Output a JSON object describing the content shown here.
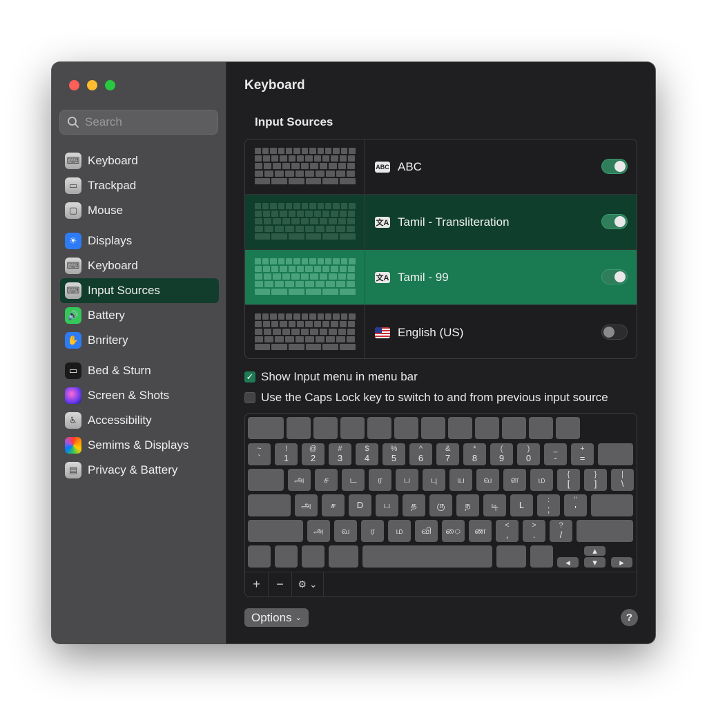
{
  "window": {
    "title": "Keyboard",
    "traffic_lights": [
      "close",
      "minimize",
      "zoom"
    ]
  },
  "sidebar": {
    "search_placeholder": "Search",
    "items": [
      {
        "label": "Keyboard",
        "icon": "keyboard-icon",
        "group": 1
      },
      {
        "label": "Trackpad",
        "icon": "trackpad-icon",
        "group": 1
      },
      {
        "label": "Mouse",
        "icon": "mouse-icon",
        "group": 1
      },
      {
        "label": "Displays",
        "icon": "sun-icon",
        "group": 2
      },
      {
        "label": "Keyboard",
        "icon": "keyboard-icon",
        "group": 2
      },
      {
        "label": "Input Sources",
        "icon": "keyboard-icon",
        "group": 2,
        "selected": true
      },
      {
        "label": "Battery",
        "icon": "speaker-icon",
        "group": 2
      },
      {
        "label": "Bnritery",
        "icon": "hand-icon",
        "group": 2
      },
      {
        "label": "Bed & Sturn",
        "icon": "display-icon",
        "group": 3
      },
      {
        "label": "Screen & Shots",
        "icon": "siri-icon",
        "group": 3
      },
      {
        "label": "Accessibility",
        "icon": "accessibility-icon",
        "group": 3
      },
      {
        "label": "Semims & Displays",
        "icon": "color-icon",
        "group": 3
      },
      {
        "label": "Privacy & Battery",
        "icon": "card-icon",
        "group": 3
      }
    ]
  },
  "main": {
    "section_title": "Input Sources",
    "sources": [
      {
        "name": "ABC",
        "icon": "abc-icon",
        "badge": "ABC",
        "enabled": true,
        "highlight": "none"
      },
      {
        "name": "Tamil - Transliteration",
        "icon": "transliteration-icon",
        "badge": "文A",
        "enabled": true,
        "highlight": "dark"
      },
      {
        "name": "Tamil - 99",
        "icon": "transliteration-icon",
        "badge": "文A",
        "enabled": true,
        "highlight": "bright"
      },
      {
        "name": "English (US)",
        "icon": "us-flag-icon",
        "badge": "",
        "enabled": false,
        "highlight": "none"
      }
    ],
    "show_input_menu": {
      "label": "Show Input menu in menu bar",
      "checked": true
    },
    "caps_lock": {
      "label": "Use the Caps Lock key to switch to and from previous input source",
      "checked": false
    },
    "keyboard_rows": [
      [],
      [
        [
          "~",
          "`"
        ],
        [
          "!",
          "1"
        ],
        [
          "@",
          "2"
        ],
        [
          "#",
          "3"
        ],
        [
          "$",
          "4"
        ],
        [
          "%",
          "5"
        ],
        [
          "^",
          "6"
        ],
        [
          "&",
          "7"
        ],
        [
          "*",
          "8"
        ],
        [
          "(",
          "9"
        ],
        [
          ")",
          "0"
        ],
        [
          "_",
          "-"
        ],
        [
          "+",
          "="
        ]
      ],
      [
        [
          "",
          "அ"
        ],
        [
          "",
          "ச"
        ],
        [
          "",
          "ட"
        ],
        [
          "",
          "ர"
        ],
        [
          "",
          "ப"
        ],
        [
          "",
          "பு"
        ],
        [
          "",
          "ய"
        ],
        [
          "",
          "வ"
        ],
        [
          "",
          "ள"
        ],
        [
          "",
          "ம"
        ],
        [
          "{",
          "["
        ],
        [
          "}",
          "]"
        ],
        [
          "|",
          "\\"
        ]
      ],
      [
        [
          "",
          "அ"
        ],
        [
          "",
          "ச"
        ],
        [
          "",
          "D"
        ],
        [
          "",
          "ப"
        ],
        [
          "",
          "த"
        ],
        [
          "",
          "ரு"
        ],
        [
          "",
          "ந"
        ],
        [
          "",
          "டி"
        ],
        [
          "",
          "L"
        ],
        [
          ":",
          ";"
        ],
        [
          "\"",
          "'"
        ]
      ],
      [
        [
          "",
          "அ"
        ],
        [
          "",
          "வ"
        ],
        [
          "",
          "ர"
        ],
        [
          "",
          "ம"
        ],
        [
          "",
          "வி"
        ],
        [
          "",
          "ை"
        ],
        [
          "",
          "ண"
        ],
        [
          "<",
          ","
        ],
        [
          ">",
          "."
        ],
        [
          "?",
          "/"
        ]
      ]
    ],
    "toolbar": {
      "add": "+",
      "remove": "−",
      "gear": "⚙ ⌄"
    },
    "options_label": "Options",
    "help_label": "?"
  }
}
